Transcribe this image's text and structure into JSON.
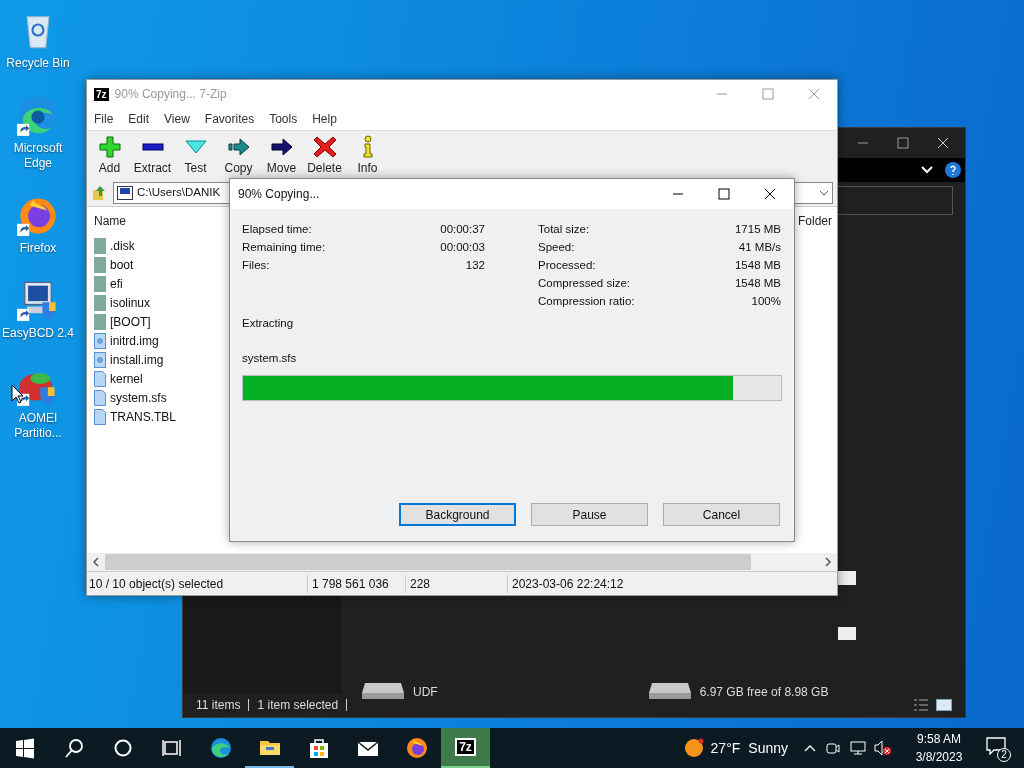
{
  "desktop_icons": [
    {
      "label": "Recycle Bin",
      "kind": "recycle",
      "shortcut": false
    },
    {
      "label": "Microsoft Edge",
      "kind": "edge",
      "shortcut": true
    },
    {
      "label": "Firefox",
      "kind": "firefox",
      "shortcut": true
    },
    {
      "label": "EasyBCD 2.4",
      "kind": "easybcd",
      "shortcut": true
    },
    {
      "label": "AOMEI Partitio...",
      "kind": "aomei",
      "shortcut": true
    }
  ],
  "explorer_window": {
    "drives": [
      {
        "label": "UDF"
      },
      {
        "label": "6.97 GB free of 8.98 GB"
      }
    ],
    "status": [
      "11 items",
      "1 item selected"
    ]
  },
  "zip_window": {
    "logo": "7z",
    "title": "90% Copying... 7-Zip",
    "menu": [
      "File",
      "Edit",
      "View",
      "Favorites",
      "Tools",
      "Help"
    ],
    "toolbar": [
      {
        "label": "Add",
        "kind": "add"
      },
      {
        "label": "Extract",
        "kind": "extract"
      },
      {
        "label": "Test",
        "kind": "test"
      },
      {
        "label": "Copy",
        "kind": "copy"
      },
      {
        "label": "Move",
        "kind": "move"
      },
      {
        "label": "Delete",
        "kind": "delete"
      },
      {
        "label": "Info",
        "kind": "info"
      }
    ],
    "address": "C:\\Users\\DANIK",
    "columns": [
      "Name",
      "Folder"
    ],
    "files": [
      {
        "name": ".disk",
        "kind": "folder"
      },
      {
        "name": "boot",
        "kind": "folder"
      },
      {
        "name": "efi",
        "kind": "folder"
      },
      {
        "name": "isolinux",
        "kind": "folder"
      },
      {
        "name": "[BOOT]",
        "kind": "folder"
      },
      {
        "name": "initrd.img",
        "kind": "image"
      },
      {
        "name": "install.img",
        "kind": "image"
      },
      {
        "name": "kernel",
        "kind": "file"
      },
      {
        "name": "system.sfs",
        "kind": "file"
      },
      {
        "name": "TRANS.TBL",
        "kind": "file"
      }
    ],
    "status": [
      "10 / 10 object(s) selected",
      "1 798 561 036",
      "228",
      "2023-03-06 22:24:12"
    ]
  },
  "dialog": {
    "title": "90% Copying...",
    "stats_left": [
      {
        "label": "Elapsed time:",
        "value": "00:00:37"
      },
      {
        "label": "Remaining time:",
        "value": "00:00:03"
      },
      {
        "label": "Files:",
        "value": "132"
      }
    ],
    "stats_right": [
      {
        "label": "Total size:",
        "value": "1715 MB"
      },
      {
        "label": "Speed:",
        "value": "41 MB/s"
      },
      {
        "label": "Processed:",
        "value": "1548 MB"
      },
      {
        "label": "Compressed size:",
        "value": "1548 MB"
      },
      {
        "label": "Compression ratio:",
        "value": "100%"
      }
    ],
    "operation": "Extracting",
    "file": "system.sfs",
    "progress": {
      "level": 0.91
    },
    "buttons": [
      {
        "label": "Background",
        "focused": true
      },
      {
        "label": "Pause",
        "focused": false
      },
      {
        "label": "Cancel",
        "focused": false
      }
    ]
  },
  "taskbar": {
    "apps": [
      {
        "kind": "start",
        "running": false,
        "active": false
      },
      {
        "kind": "search",
        "running": false,
        "active": false
      },
      {
        "kind": "cortana",
        "running": false,
        "active": false
      },
      {
        "kind": "taskview",
        "running": false,
        "active": false
      },
      {
        "kind": "edge",
        "running": false,
        "active": false
      },
      {
        "kind": "explorer",
        "running": true,
        "active": false
      },
      {
        "kind": "store",
        "running": false,
        "active": false
      },
      {
        "kind": "mail",
        "running": false,
        "active": false
      },
      {
        "kind": "firefox",
        "running": false,
        "active": false
      },
      {
        "kind": "sevenzip",
        "running": true,
        "active": true,
        "logo": "7z"
      }
    ],
    "weather": {
      "temp": "27°F",
      "condition": "Sunny"
    },
    "time": "9:58 AM",
    "date": "3/8/2023",
    "notifications": "2"
  }
}
